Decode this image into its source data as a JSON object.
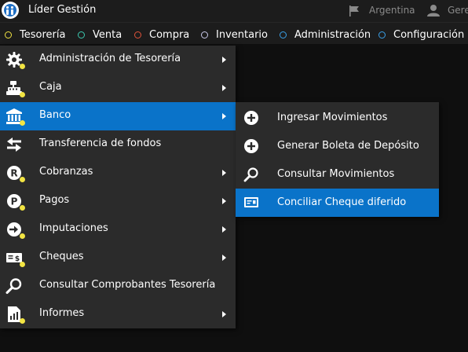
{
  "header": {
    "app_title": "Líder Gestión",
    "country": "Argentina",
    "user": "Gere"
  },
  "nav": [
    {
      "label": "Tesorería",
      "color": "#f2e443"
    },
    {
      "label": "Venta",
      "color": "#3cc9b0"
    },
    {
      "label": "Compra",
      "color": "#e0533a"
    },
    {
      "label": "Inventario",
      "color": "#c8c8e8"
    },
    {
      "label": "Administración",
      "color": "#3aa0e8"
    },
    {
      "label": "Configuración",
      "color": "#3aa0e8"
    }
  ],
  "menu": {
    "items": [
      {
        "label": "Administración de Tesorería",
        "icon": "gear-icon",
        "submenu": true
      },
      {
        "label": "Caja",
        "icon": "cash-register-icon",
        "submenu": true
      },
      {
        "label": "Banco",
        "icon": "bank-icon",
        "submenu": true,
        "active": true
      },
      {
        "label": "Transferencia de fondos",
        "icon": "transfer-arrows-icon",
        "submenu": false
      },
      {
        "label": "Cobranzas",
        "icon": "r-circle-icon",
        "submenu": true
      },
      {
        "label": "Pagos",
        "icon": "p-circle-icon",
        "submenu": true
      },
      {
        "label": "Imputaciones",
        "icon": "arrow-in-circle-icon",
        "submenu": true
      },
      {
        "label": "Cheques",
        "icon": "check-money-icon",
        "submenu": true
      },
      {
        "label": "Consultar Comprobantes Tesorería",
        "icon": "search-icon",
        "submenu": false
      },
      {
        "label": "Informes",
        "icon": "report-chart-icon",
        "submenu": true
      }
    ]
  },
  "submenu": {
    "items": [
      {
        "label": "Ingresar Movimientos",
        "icon": "plus-circle-icon"
      },
      {
        "label": "Generar Boleta de Depósito",
        "icon": "plus-circle-icon"
      },
      {
        "label": "Consultar Movimientos",
        "icon": "search-icon"
      },
      {
        "label": "Conciliar Cheque diferido",
        "icon": "check-document-icon",
        "active": true
      }
    ]
  }
}
